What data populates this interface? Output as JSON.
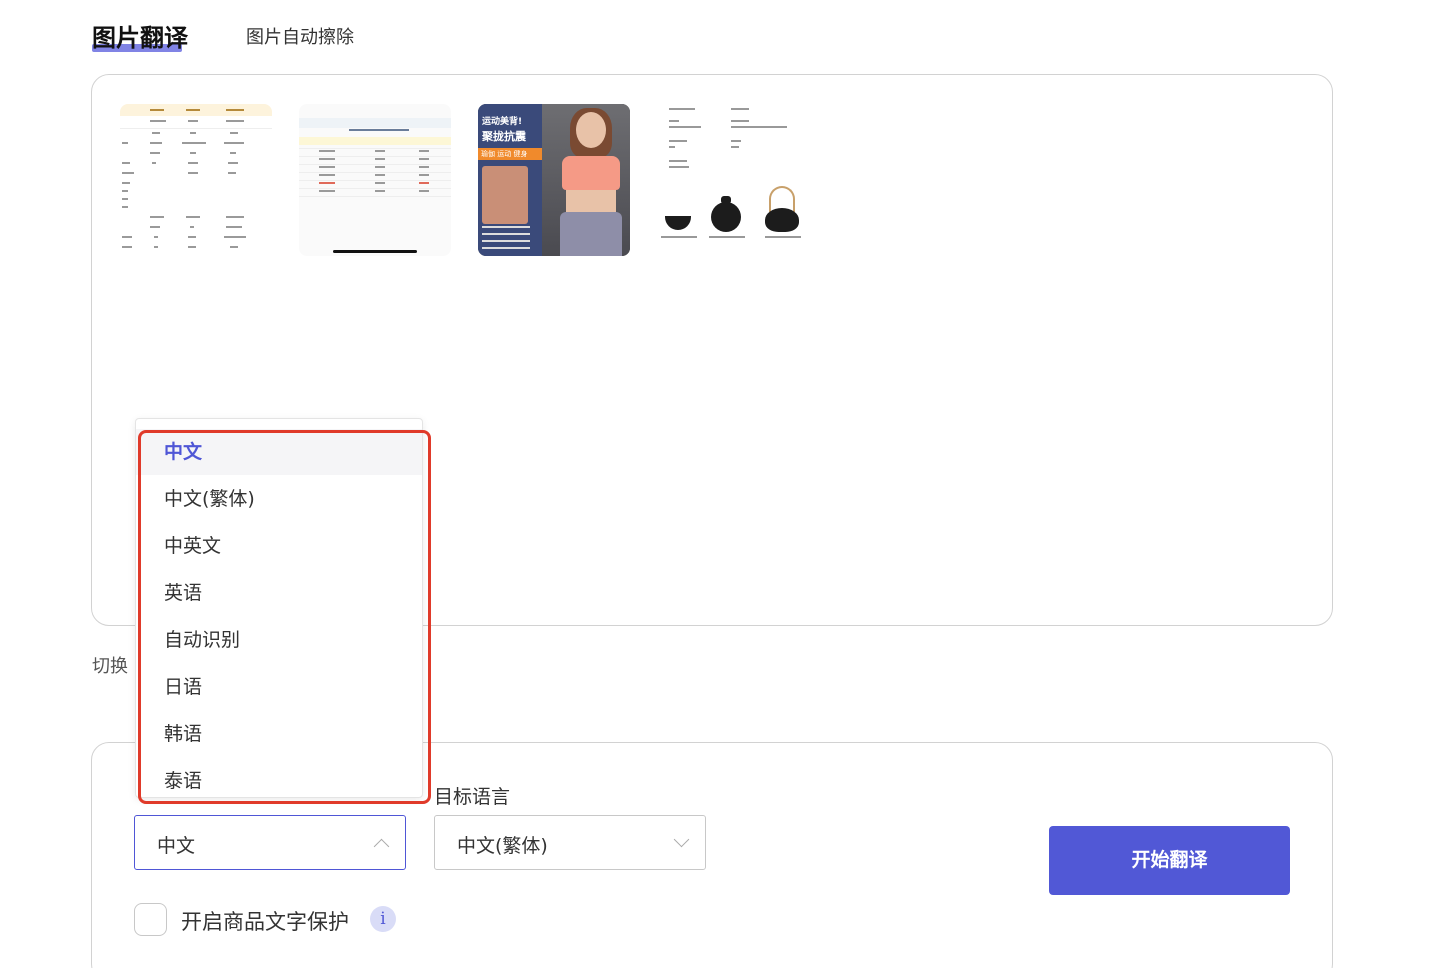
{
  "tabs": {
    "active": "图片翻译",
    "inactive": "图片自动擦除"
  },
  "thumbnails": {
    "t3_title1": "运动美背!",
    "t3_title2": "聚拢抗震",
    "t3_tag": "瑜伽 运动 健身"
  },
  "switch_label": "切换",
  "dropdown": {
    "options": [
      "中文",
      "中文(繁体)",
      "中英文",
      "英语",
      "自动识别",
      "日语",
      "韩语",
      "泰语"
    ],
    "selected": "中文"
  },
  "settings": {
    "source_label": "",
    "target_label": "目标语言",
    "source_value": "中文",
    "target_value": "中文(繁体)",
    "start_button": "开始翻译",
    "protect_label": "开启商品文字保护",
    "info_icon": "i"
  },
  "colors": {
    "accent": "#5158d6",
    "highlight": "#e03a2a"
  }
}
